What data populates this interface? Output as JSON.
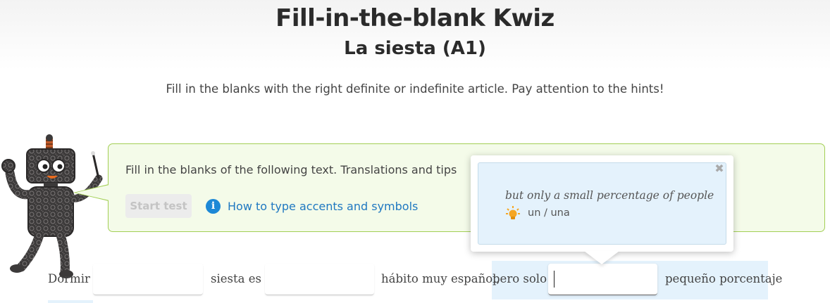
{
  "header": {
    "title": "Fill-in-the-blank Kwiz",
    "subtitle": "La siesta (A1)",
    "instructions": "Fill in the blanks with the right definite or indefinite article. Pay attention to the hints!"
  },
  "intro": {
    "text": "Fill in the blanks of the following text. Translations and tips",
    "start_button": "Start test",
    "accents_link": "How to type accents and symbols",
    "info_icon_glyph": "i"
  },
  "hint_popover": {
    "translation": "but only a small percentage of people",
    "answer": "un / una",
    "close_glyph": "✖"
  },
  "sentence": {
    "words": [
      "Dormir",
      "siesta  es",
      "hábito muy español,",
      "pero solo",
      "pequeño porcentaje"
    ],
    "blanks": [
      "",
      "",
      ""
    ]
  },
  "colors": {
    "accent_green": "#a3cf55",
    "panel_green": "#f4fbe9",
    "link_blue": "#1f78c1",
    "hint_blue": "#e4f2fc"
  },
  "icons": {
    "mascot": "robot-mascot-icon",
    "info": "info-icon",
    "hint": "lightbulb-icon",
    "close": "close-icon"
  }
}
